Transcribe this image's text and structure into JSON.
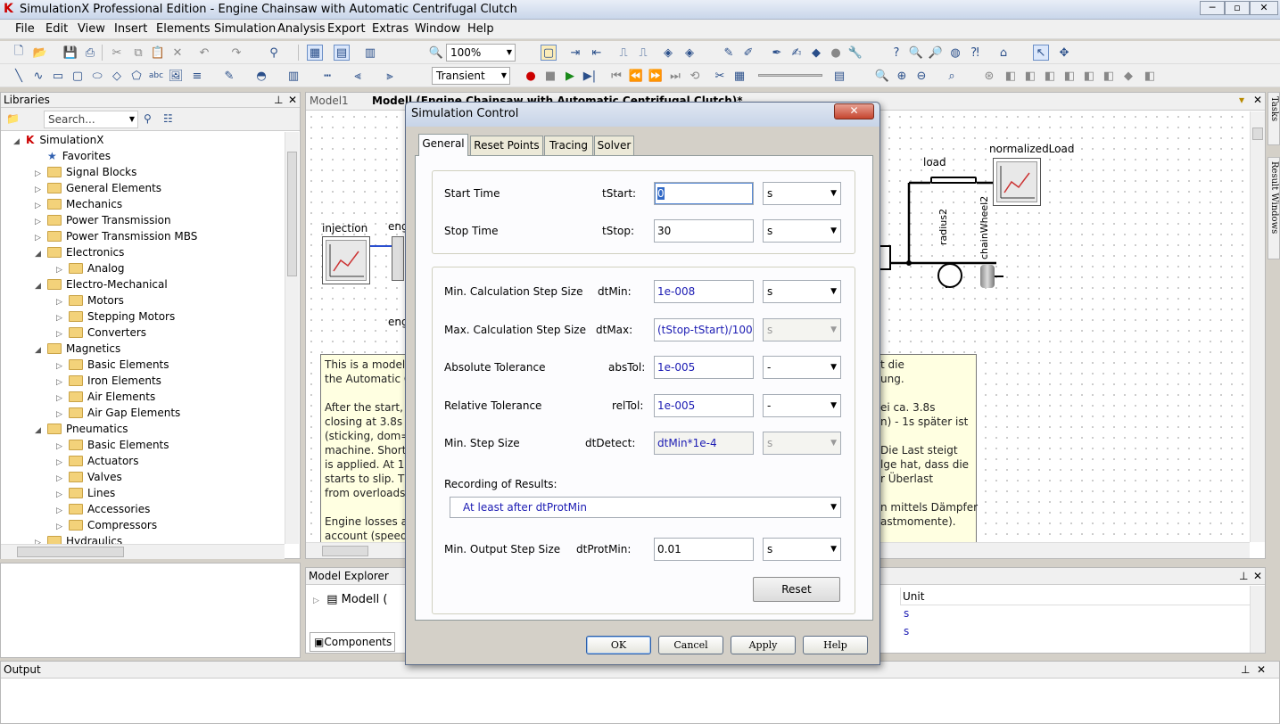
{
  "app": {
    "title": "SimulationX Professional Edition - Engine Chainsaw with Automatic Centrifugal Clutch"
  },
  "menu": [
    "File",
    "Edit",
    "View",
    "Insert",
    "Elements",
    "Simulation",
    "Analysis",
    "Export",
    "Extras",
    "Window",
    "Help"
  ],
  "toolbar": {
    "zoom": "100%",
    "sim_mode": "Transient"
  },
  "libraries": {
    "title": "Libraries",
    "search_placeholder": "Search...",
    "tree": [
      {
        "label": "SimulationX",
        "level": 0,
        "exp": "◢"
      },
      {
        "label": "Favorites",
        "level": 1,
        "exp": ""
      },
      {
        "label": "Signal Blocks",
        "level": 1,
        "exp": "▷"
      },
      {
        "label": "General Elements",
        "level": 1,
        "exp": "▷"
      },
      {
        "label": "Mechanics",
        "level": 1,
        "exp": "▷"
      },
      {
        "label": "Power Transmission",
        "level": 1,
        "exp": "▷"
      },
      {
        "label": "Power Transmission MBS",
        "level": 1,
        "exp": "▷"
      },
      {
        "label": "Electronics",
        "level": 1,
        "exp": "◢"
      },
      {
        "label": "Analog",
        "level": 2,
        "exp": "▷"
      },
      {
        "label": "Electro-Mechanical",
        "level": 1,
        "exp": "◢"
      },
      {
        "label": "Motors",
        "level": 2,
        "exp": "▷"
      },
      {
        "label": "Stepping Motors",
        "level": 2,
        "exp": "▷"
      },
      {
        "label": "Converters",
        "level": 2,
        "exp": "▷"
      },
      {
        "label": "Magnetics",
        "level": 1,
        "exp": "◢"
      },
      {
        "label": "Basic Elements",
        "level": 2,
        "exp": "▷"
      },
      {
        "label": "Iron Elements",
        "level": 2,
        "exp": "▷"
      },
      {
        "label": "Air Elements",
        "level": 2,
        "exp": "▷"
      },
      {
        "label": "Air Gap Elements",
        "level": 2,
        "exp": "▷"
      },
      {
        "label": "Pneumatics",
        "level": 1,
        "exp": "◢"
      },
      {
        "label": "Basic Elements",
        "level": 2,
        "exp": "▷"
      },
      {
        "label": "Actuators",
        "level": 2,
        "exp": "▷"
      },
      {
        "label": "Valves",
        "level": 2,
        "exp": "▷"
      },
      {
        "label": "Lines",
        "level": 2,
        "exp": "▷"
      },
      {
        "label": "Accessories",
        "level": 2,
        "exp": "▷"
      },
      {
        "label": "Compressors",
        "level": 2,
        "exp": "▷"
      },
      {
        "label": "Hydraulics",
        "level": 1,
        "exp": "▷"
      }
    ]
  },
  "model": {
    "tabs": [
      "Model1",
      "Modell (Engine Chainsaw with Automatic Centrifugal Clutch)*"
    ],
    "elements": {
      "injection": "injection",
      "load": "load",
      "normalizedLoad": "normalizedLoad",
      "radius2": "radius2",
      "chainWheel2": "chainWheel2",
      "eng_top": "eng",
      "eng_bottom": "eng"
    },
    "desc_left": [
      "This is a model",
      "the Automatic C",
      "",
      "After the start, t",
      "closing at 3.8s (",
      "(sticking, dom=",
      "machine. Shortl",
      "is applied. At 16",
      "starts to slip. Th",
      "from overloads.",
      "",
      "Engine losses as",
      "account (speed-"
    ],
    "desc_right": [
      "t die",
      "ung.",
      "",
      "ei ca. 3.8s",
      "n) - 1s später ist",
      "",
      "Die Last steigt",
      "lge hat, dass die",
      "r Überlast",
      "",
      "n mittels Dämpfer",
      "astmomente)."
    ]
  },
  "explorer": {
    "title": "Model Explorer",
    "row": "Modell (",
    "tab": "Components",
    "unit_header": "Unit",
    "units": [
      "s",
      "s"
    ]
  },
  "output": {
    "title": "Output"
  },
  "side_tabs": [
    "Tasks",
    "Result Windows"
  ],
  "dialog": {
    "title": "Simulation Control",
    "tabs": [
      "General",
      "Reset Points",
      "Tracing",
      "Solver"
    ],
    "start_time": {
      "label": "Start Time",
      "param": "tStart:",
      "value": "0",
      "unit": "s"
    },
    "stop_time": {
      "label": "Stop Time",
      "param": "tStop:",
      "value": "30",
      "unit": "s"
    },
    "dt_min": {
      "label": "Min. Calculation Step Size",
      "param": "dtMin:",
      "value": "1e-008",
      "unit": "s"
    },
    "dt_max": {
      "label": "Max. Calculation Step Size",
      "param": "dtMax:",
      "value": "(tStop-tStart)/100",
      "unit": "s"
    },
    "abs_tol": {
      "label": "Absolute Tolerance",
      "param": "absTol:",
      "value": "1e-005",
      "unit": "-"
    },
    "rel_tol": {
      "label": "Relative Tolerance",
      "param": "relTol:",
      "value": "1e-005",
      "unit": "-"
    },
    "dt_detect": {
      "label": "Min. Step Size",
      "param": "dtDetect:",
      "value": "dtMin*1e-4",
      "unit": "s"
    },
    "recording": {
      "label": "Recording of Results:",
      "value": "At least after dtProtMin"
    },
    "dt_prot": {
      "label": "Min. Output Step Size",
      "param": "dtProtMin:",
      "value": "0.01",
      "unit": "s"
    },
    "reset_label": "Reset",
    "buttons": {
      "ok": "OK",
      "cancel": "Cancel",
      "apply": "Apply",
      "help": "Help"
    }
  }
}
